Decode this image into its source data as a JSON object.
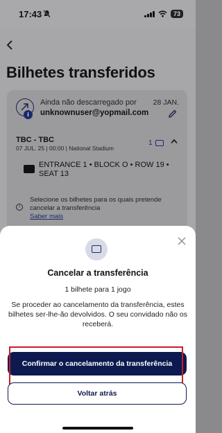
{
  "status_bar": {
    "time": "17:43",
    "battery": "73"
  },
  "page": {
    "title": "Bilhetes transferidos"
  },
  "transfer_card": {
    "status": "Ainda não descarregado por",
    "recipient_email": "unknownuser@yopmail.com",
    "date": "28 JAN.",
    "event_name": "TBC - TBC",
    "event_info": "07 JUL. 25 | 00:00 | National Stadium",
    "ticket_count": "1",
    "seat": "ENTRANCE 1 • BLOCK O • ROW 19 • SEAT 13",
    "helper_text": "Selecione os bilhetes para os quais pretende cancelar a transferência",
    "learn_more_link": "Saber mais"
  },
  "modal": {
    "title": "Cancelar a transferência",
    "subtitle": "1 bilhete para 1 jogo",
    "body": "Se proceder ao cancelamento da transferência, estes bilhetes ser-lhe-ão devolvidos. O seu convidado não os receberá.",
    "confirm_button": "Confirmar o cancelamento da transferência",
    "back_button": "Voltar atrás"
  },
  "colors": {
    "brand_navy": "#0d1a4f",
    "highlight_red": "#c81e24"
  },
  "icons": [
    "back-arrow-icon",
    "transfer-icon",
    "info-icon",
    "edit-pencil-icon",
    "ticket-icon",
    "chevron-up-icon",
    "close-icon",
    "cancel-transfer-icon"
  ]
}
